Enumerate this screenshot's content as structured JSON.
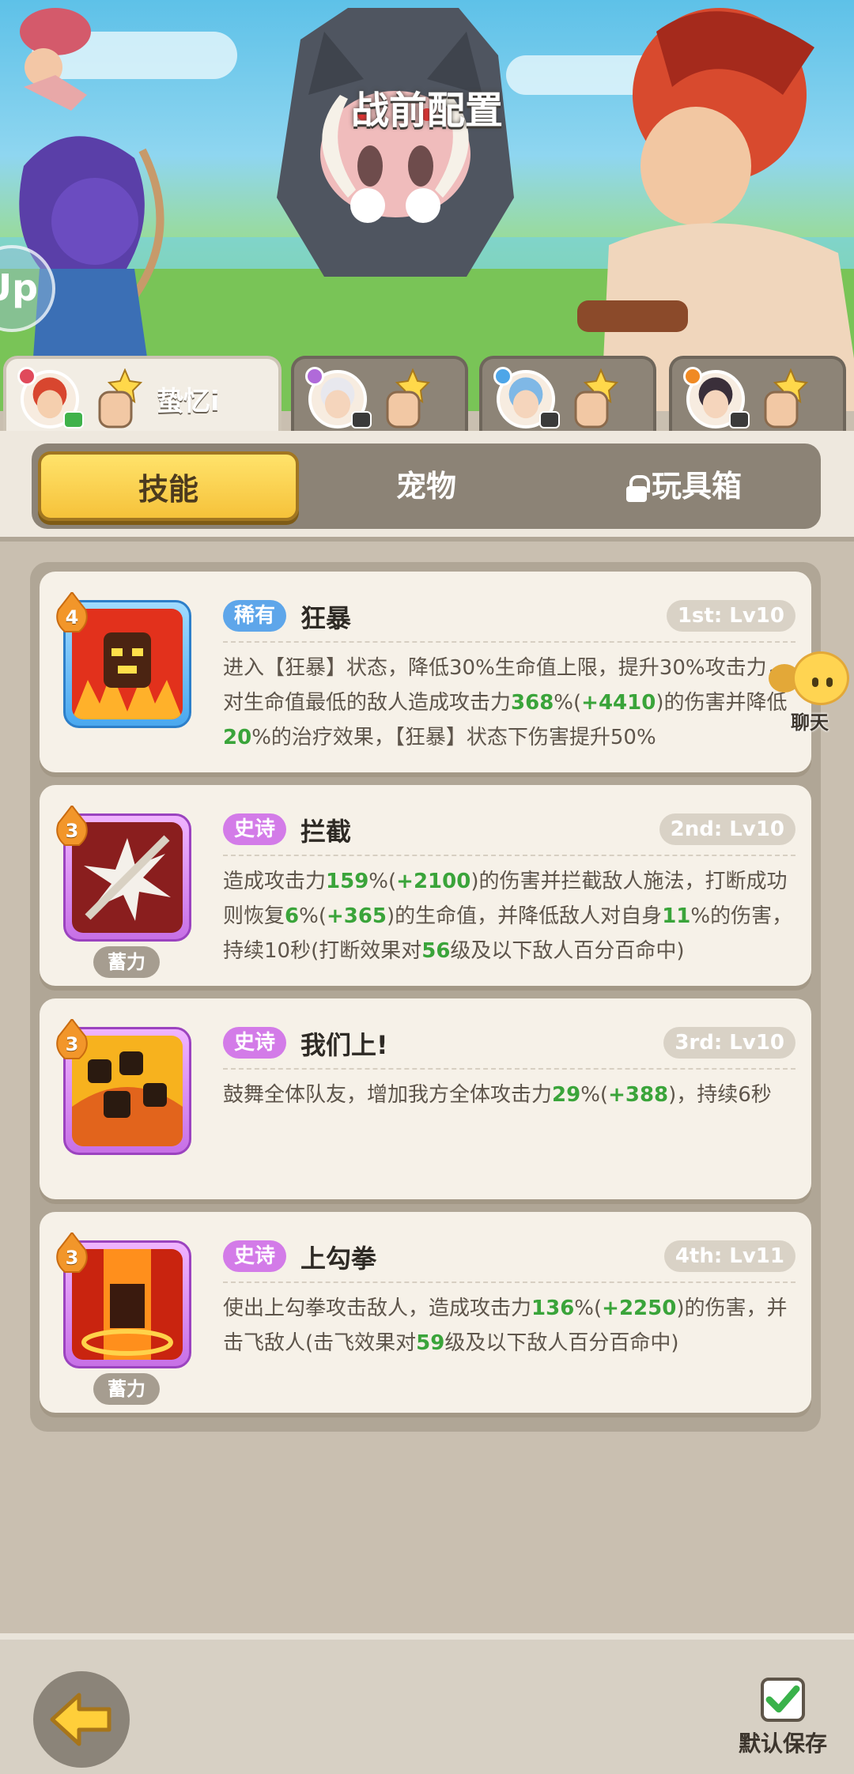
{
  "screen": {
    "title": "战前配置"
  },
  "hero_banner": {
    "side_button_label": "Up"
  },
  "characters": [
    {
      "name": "蛰忆i",
      "element_color": "#e04a5b",
      "status_color": "#3fb24a",
      "active": true
    },
    {
      "name": "",
      "element_color": "#b06ad9",
      "status_color": "#3a3a3a",
      "active": false
    },
    {
      "name": "",
      "element_color": "#4ea6e8",
      "status_color": "#3a3a3a",
      "active": false
    },
    {
      "name": "",
      "element_color": "#f08a24",
      "status_color": "#3a3a3a",
      "active": false
    }
  ],
  "tabs": [
    {
      "label": "技能",
      "active": true
    },
    {
      "label": "宠物",
      "active": false
    },
    {
      "label": "玩具箱",
      "locked": true,
      "active": false
    }
  ],
  "skills": [
    {
      "level": "4",
      "rarity": "稀有",
      "rarity_type": "rare",
      "name": "狂暴",
      "slot": "1st: Lv10",
      "charge": "",
      "desc_parts": [
        [
          "t",
          "进入【狂暴】状态，降低30%生命值上限，提升30%攻击力，对生命值最低的敌人造成攻击力"
        ],
        [
          "g",
          "368"
        ],
        [
          "t",
          "%("
        ],
        [
          "g",
          "+4410"
        ],
        [
          "t",
          ")的伤害并降低"
        ],
        [
          "g",
          "20"
        ],
        [
          "t",
          "%的治疗效果，【狂暴】状态下伤害提升50%"
        ]
      ]
    },
    {
      "level": "3",
      "rarity": "史诗",
      "rarity_type": "epic",
      "name": "拦截",
      "slot": "2nd: Lv10",
      "charge": "蓄力",
      "desc_parts": [
        [
          "t",
          "造成攻击力"
        ],
        [
          "g",
          "159"
        ],
        [
          "t",
          "%("
        ],
        [
          "g",
          "+2100"
        ],
        [
          "t",
          ")的伤害并拦截敌人施法，打断成功则恢复"
        ],
        [
          "g",
          "6"
        ],
        [
          "t",
          "%("
        ],
        [
          "g",
          "+365"
        ],
        [
          "t",
          ")的生命值，并降低敌人对自身"
        ],
        [
          "g",
          "11"
        ],
        [
          "t",
          "%的伤害，持续10秒(打断效果对"
        ],
        [
          "g",
          "56"
        ],
        [
          "t",
          "级及以下敌人百分百命中)"
        ]
      ]
    },
    {
      "level": "3",
      "rarity": "史诗",
      "rarity_type": "epic",
      "name": "我们上!",
      "slot": "3rd: Lv10",
      "charge": "",
      "desc_parts": [
        [
          "t",
          "鼓舞全体队友，增加我方全体攻击力"
        ],
        [
          "g",
          "29"
        ],
        [
          "t",
          "%("
        ],
        [
          "g",
          "+388"
        ],
        [
          "t",
          ")，持续6秒"
        ]
      ]
    },
    {
      "level": "3",
      "rarity": "史诗",
      "rarity_type": "epic",
      "name": "上勾拳",
      "slot": "4th: Lv11",
      "charge": "蓄力",
      "desc_parts": [
        [
          "t",
          "使出上勾拳攻击敌人，造成攻击力"
        ],
        [
          "g",
          "136"
        ],
        [
          "t",
          "%("
        ],
        [
          "g",
          "+2250"
        ],
        [
          "t",
          ")的伤害，并击飞敌人(击飞效果对"
        ],
        [
          "g",
          "59"
        ],
        [
          "t",
          "级及以下敌人百分百命中)"
        ]
      ]
    }
  ],
  "chat_float": {
    "label": "聊天"
  },
  "footer": {
    "save_label": "默认保存"
  },
  "colors": {
    "panel_bg": "#c9bfb0",
    "tab_active": "#f6c23a",
    "green_value": "#3aa43a",
    "rare": "#5ea6ea",
    "epic": "#d37be8"
  }
}
